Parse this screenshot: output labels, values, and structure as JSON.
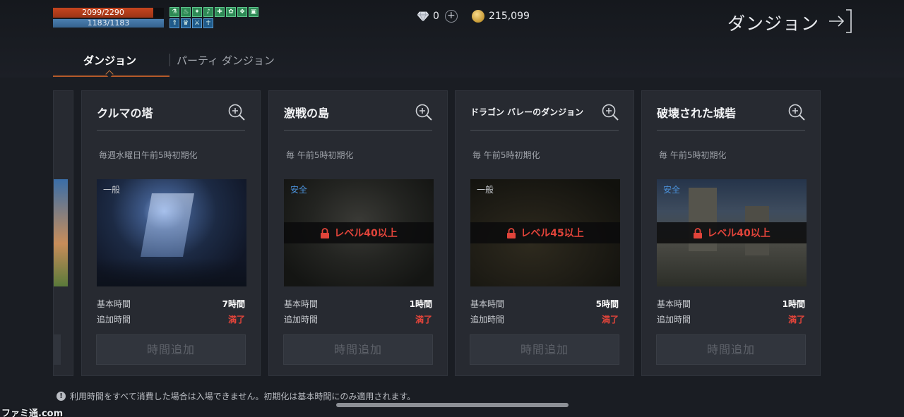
{
  "status": {
    "hp": "2099/2290",
    "mp": "1183/1183",
    "buffs_row1": [
      "⚗",
      "♨",
      "✦",
      "♪",
      "✚",
      "✿",
      "❖",
      "▣",
      "♦",
      "⚑"
    ],
    "buffs_row2": [
      "⇑",
      "♛",
      "⚔",
      "☥"
    ]
  },
  "currency": {
    "gem_count": "0",
    "gold_count": "215,099"
  },
  "header": {
    "title": "ダンジョン"
  },
  "tabs": [
    {
      "label": "ダンジョン",
      "active": true
    },
    {
      "label": "パーティ ダンジョン",
      "active": false
    }
  ],
  "cards": [
    {
      "title": "クルマの塔",
      "reset": "毎週水曜日午前5時初期化",
      "tag": "一般",
      "locked": false,
      "lock_text": "",
      "base_label": "基本時間",
      "base_value": "7時間",
      "extra_label": "追加時間",
      "extra_value": "満了",
      "button": "時間追加"
    },
    {
      "title": "激戦の島",
      "reset": "毎 午前5時初期化",
      "tag": "安全",
      "locked": true,
      "lock_text": "レベル40以上",
      "base_label": "基本時間",
      "base_value": "1時間",
      "extra_label": "追加時間",
      "extra_value": "満了",
      "button": "時間追加"
    },
    {
      "title": "ドラゴン バレーのダンジョン",
      "reset": "毎 午前5時初期化",
      "tag": "一般",
      "locked": true,
      "lock_text": "レベル45以上",
      "base_label": "基本時間",
      "base_value": "5時間",
      "extra_label": "追加時間",
      "extra_value": "満了",
      "button": "時間追加"
    },
    {
      "title": "破壊された城砦",
      "reset": "毎 午前5時初期化",
      "tag": "安全",
      "locked": true,
      "lock_text": "レベル40以上",
      "base_label": "基本時間",
      "base_value": "1時間",
      "extra_label": "追加時間",
      "extra_value": "満了",
      "button": "時間追加"
    }
  ],
  "footer": {
    "notice": "利用時間をすべて消費した場合は入場できません。初期化は基本時間にのみ適用されます。",
    "watermark": "ファミ通.com"
  },
  "colors": {
    "accent_underline": "#b55a2a",
    "lock_red": "#e2443a",
    "safe_blue": "#4a8fd6"
  },
  "icons": {
    "zoom": "zoom-in-icon",
    "lock": "lock-icon",
    "exit": "exit-icon",
    "gem": "diamond-icon",
    "gold": "gold-coin-icon",
    "info": "info-icon"
  }
}
